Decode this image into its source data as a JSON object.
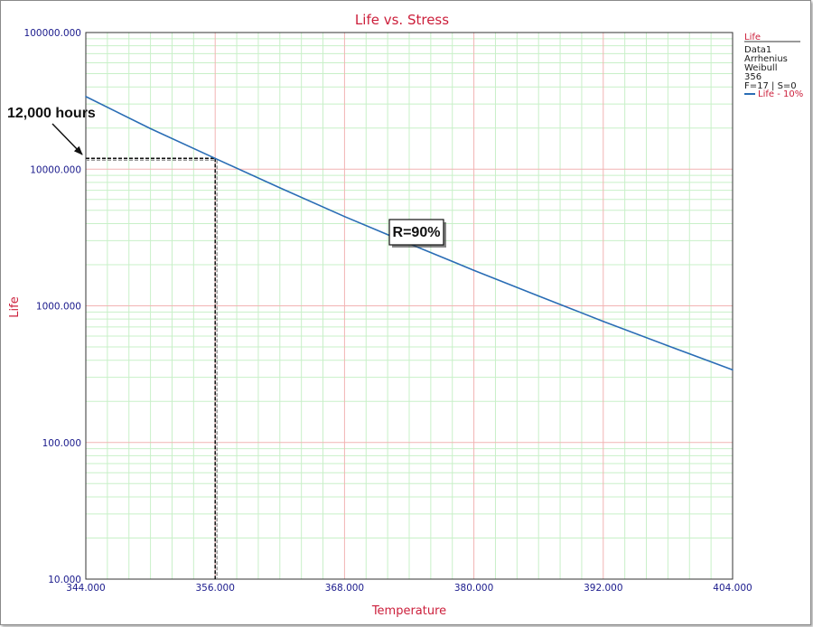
{
  "chart_data": {
    "type": "line",
    "title": "Life vs. Stress",
    "xlabel": "Temperature",
    "ylabel": "Life",
    "xlim": [
      344,
      404
    ],
    "ylim": [
      10,
      100000
    ],
    "yscale": "log",
    "grid": true,
    "x_ticks": [
      "344.000",
      "356.000",
      "368.000",
      "380.000",
      "392.000",
      "404.000"
    ],
    "y_ticks": [
      "10.000",
      "100.000",
      "1000.000",
      "10000.000",
      "100000.000"
    ],
    "series": [
      {
        "name": "Life - 10%",
        "color": "#2a6db5",
        "x": [
          344,
          350,
          356,
          362,
          368,
          374,
          380,
          386,
          392,
          398,
          404
        ],
        "y": [
          34000,
          19800,
          12000,
          7300,
          4500,
          2850,
          1820,
          1180,
          770,
          510,
          340
        ]
      }
    ],
    "legend": {
      "position": "top-right",
      "header": "Life",
      "lines": [
        "Data1",
        "Arrhenius",
        "Weibull",
        "356",
        "F=17 | S=0"
      ]
    },
    "annotations": {
      "hours_label": "12,000 hours",
      "reliability_label": "R=90%",
      "reference_x": 356,
      "reference_y": 12000
    }
  }
}
